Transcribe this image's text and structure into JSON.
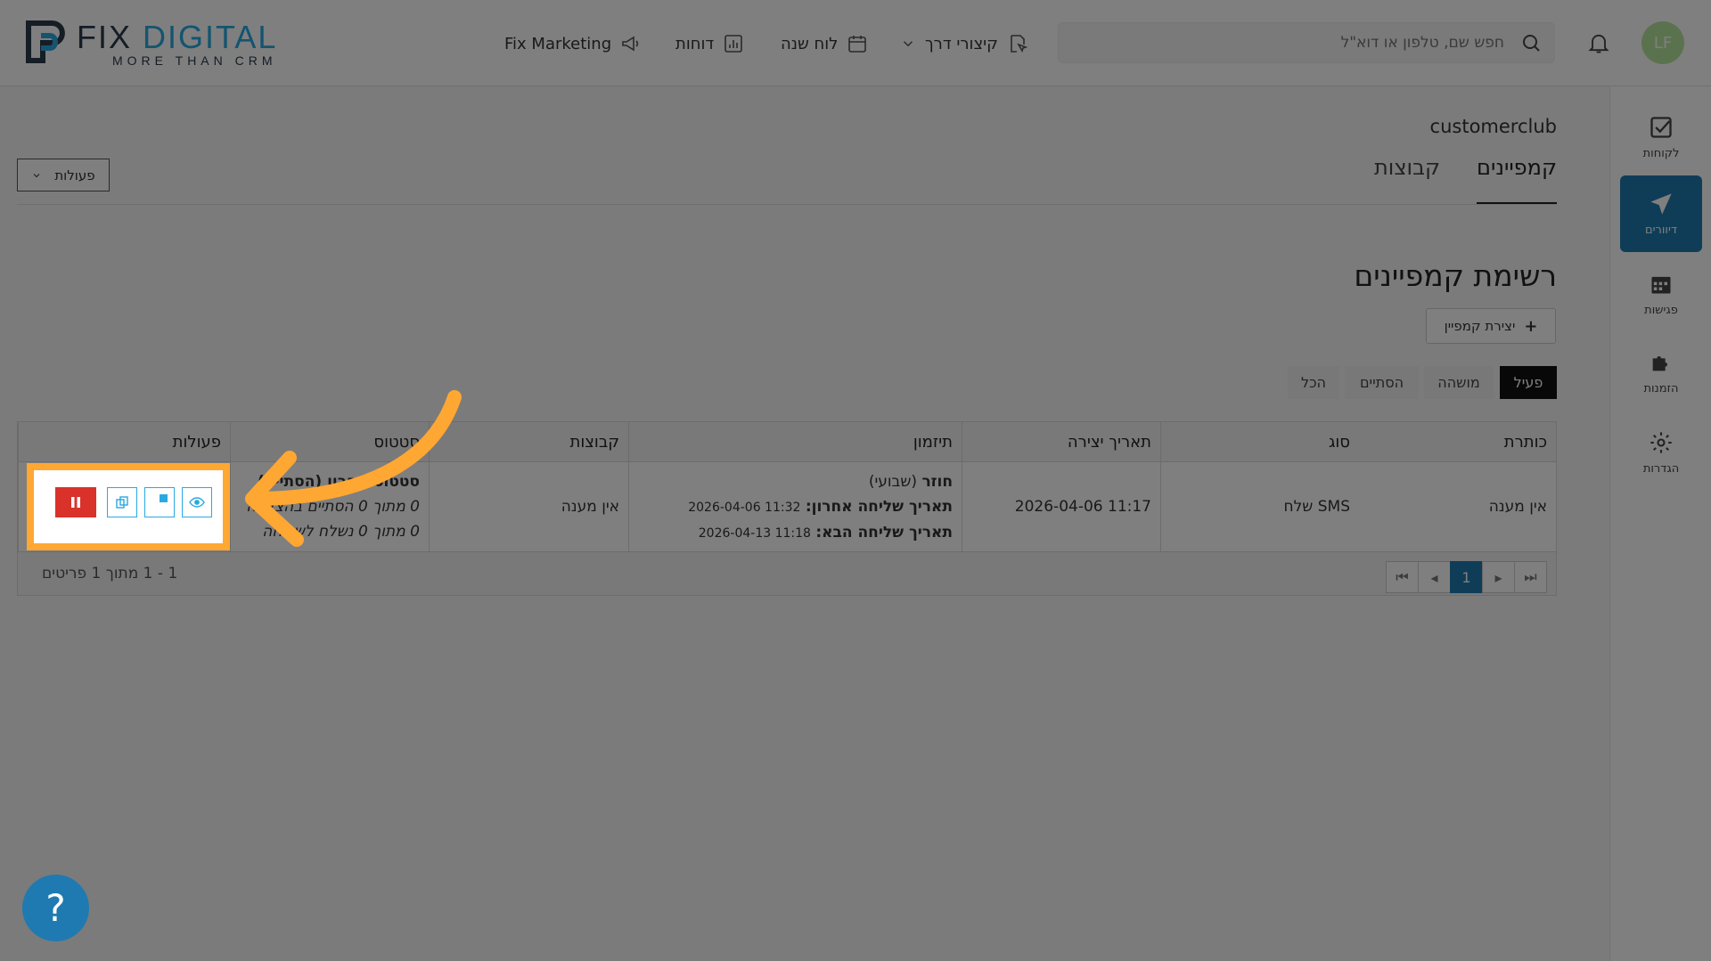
{
  "header": {
    "logo": {
      "word1": "FIX",
      "word2": "DIGITAL",
      "tagline": "MORE THAN CRM"
    },
    "nav": [
      {
        "label": "Fix Marketing",
        "icon": "megaphone-icon"
      },
      {
        "label": "דוחות",
        "icon": "chart-icon"
      },
      {
        "label": "לוח שנה",
        "icon": "calendar-icon"
      },
      {
        "label": "קיצורי דרך",
        "icon": "shortcut-icon"
      }
    ],
    "search_placeholder": "חפש שם, טלפון או דוא\"ל",
    "avatar_initials": "LF"
  },
  "sidebar": {
    "items": [
      {
        "label": "לקוחות",
        "icon": "checkbox-icon"
      },
      {
        "label": "דיוורים",
        "icon": "send-icon",
        "active": true
      },
      {
        "label": "פגישות",
        "icon": "calendar-icon"
      },
      {
        "label": "הזמנות",
        "icon": "puzzle-icon"
      },
      {
        "label": "הגדרות",
        "icon": "gear-icon"
      }
    ]
  },
  "main": {
    "breadcrumb": "customerclub",
    "tabs": [
      {
        "label": "קמפיינים",
        "active": true
      },
      {
        "label": "קבוצות"
      }
    ],
    "actions_label": "פעולות",
    "page_title": "רשימת קמפיינים",
    "create_button": "יצירת קמפיין",
    "filters": [
      {
        "label": "פעיל",
        "active": true
      },
      {
        "label": "מושהה"
      },
      {
        "label": "הסתיים"
      },
      {
        "label": "הכל"
      }
    ]
  },
  "table": {
    "headers": [
      "כותרת",
      "סוג",
      "תאריך יצירה",
      "תיזמון",
      "קבוצות",
      "סטטוס",
      "פעולות"
    ],
    "row": {
      "title": "אין מענה",
      "type": "שלח SMS",
      "created": "2026-04-06 11:17",
      "schedule_type": "חוזר",
      "schedule_freq": "(שבועי)",
      "last_send_label": "תאריך שליחה אחרון:",
      "last_send_value": "2026-04-06 11:32",
      "next_send_label": "תאריך שליחה הבא:",
      "next_send_value": "2026-04-13 11:18",
      "groups": "אין מענה",
      "status_title": "סטטוס אחרון (הסתיים)",
      "status_line1": "0 מתוך 0 הסתיים בהצלחה",
      "status_line2": "0 מתוך 0 נשלח לשליחה"
    },
    "footer_count": "1 - 1 מתוך 1 פריטים",
    "current_page": "1"
  },
  "help_label": "?"
}
